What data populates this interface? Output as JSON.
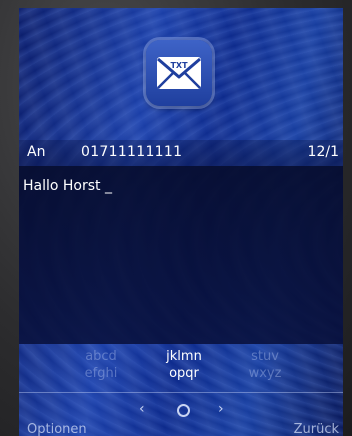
{
  "compose": {
    "to_label": "An",
    "to_number": "01711111111",
    "counter": "12/1",
    "message_text": "Hallo Horst _"
  },
  "keypad": {
    "groups": [
      {
        "top": "abcd",
        "bottom": "efghi",
        "state": "inactive"
      },
      {
        "top": "jklmn",
        "bottom": "opqr",
        "state": "active"
      },
      {
        "top": "stuv",
        "bottom": "wxyz",
        "state": "inactive"
      }
    ]
  },
  "nav": {
    "left_arrow": "‹",
    "right_arrow": "›"
  },
  "softkeys": {
    "left": "Optionen",
    "right": "Zurück"
  },
  "icons": {
    "message_icon": "txt-envelope-icon",
    "icon_text": "TXT"
  },
  "colors": {
    "background_blue": "#1b3fa8",
    "text_white": "#ffffff",
    "dim_text": "#8fa0d6"
  }
}
